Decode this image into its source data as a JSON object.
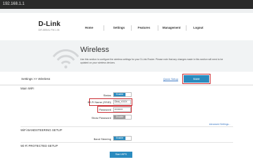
{
  "browser": {
    "url": "192.168.1.1"
  },
  "header": {
    "brand": "D-Link",
    "model": "DIR-859/A1 FW:1.06",
    "nav": [
      "Home",
      "Settings",
      "Features",
      "Management",
      "Logout"
    ]
  },
  "hero": {
    "title": "Wireless",
    "description": "Use this section to configure the wireless settings for your D-Link Router. Please note that any changes made in this section will need to be updated on your wireless devices."
  },
  "settings_bar": {
    "breadcrumb": "Settings >> Wireless",
    "quick_link": "Quick Setup",
    "save_label": "Save"
  },
  "wifi": {
    "section_title": "Main WiFi",
    "status_label": "Status",
    "status_value": "Enable",
    "ssid_label": "Wi-Fi Name (SSID)",
    "ssid_value": "Dlink_XXXX",
    "password_label": "Password",
    "password_value": "••••••••••",
    "show_password_label": "Show Password",
    "show_password_value": "Disable",
    "advanced_link": "Advanced Settings..."
  },
  "band_steering": {
    "section_title": "WiFi BANDSTEERING SETUP",
    "label": "Band Steering",
    "value": "Enable"
  },
  "wps": {
    "section_title": "Wi-Fi PROTECTED SETUP",
    "button_label": "Start WPS"
  }
}
